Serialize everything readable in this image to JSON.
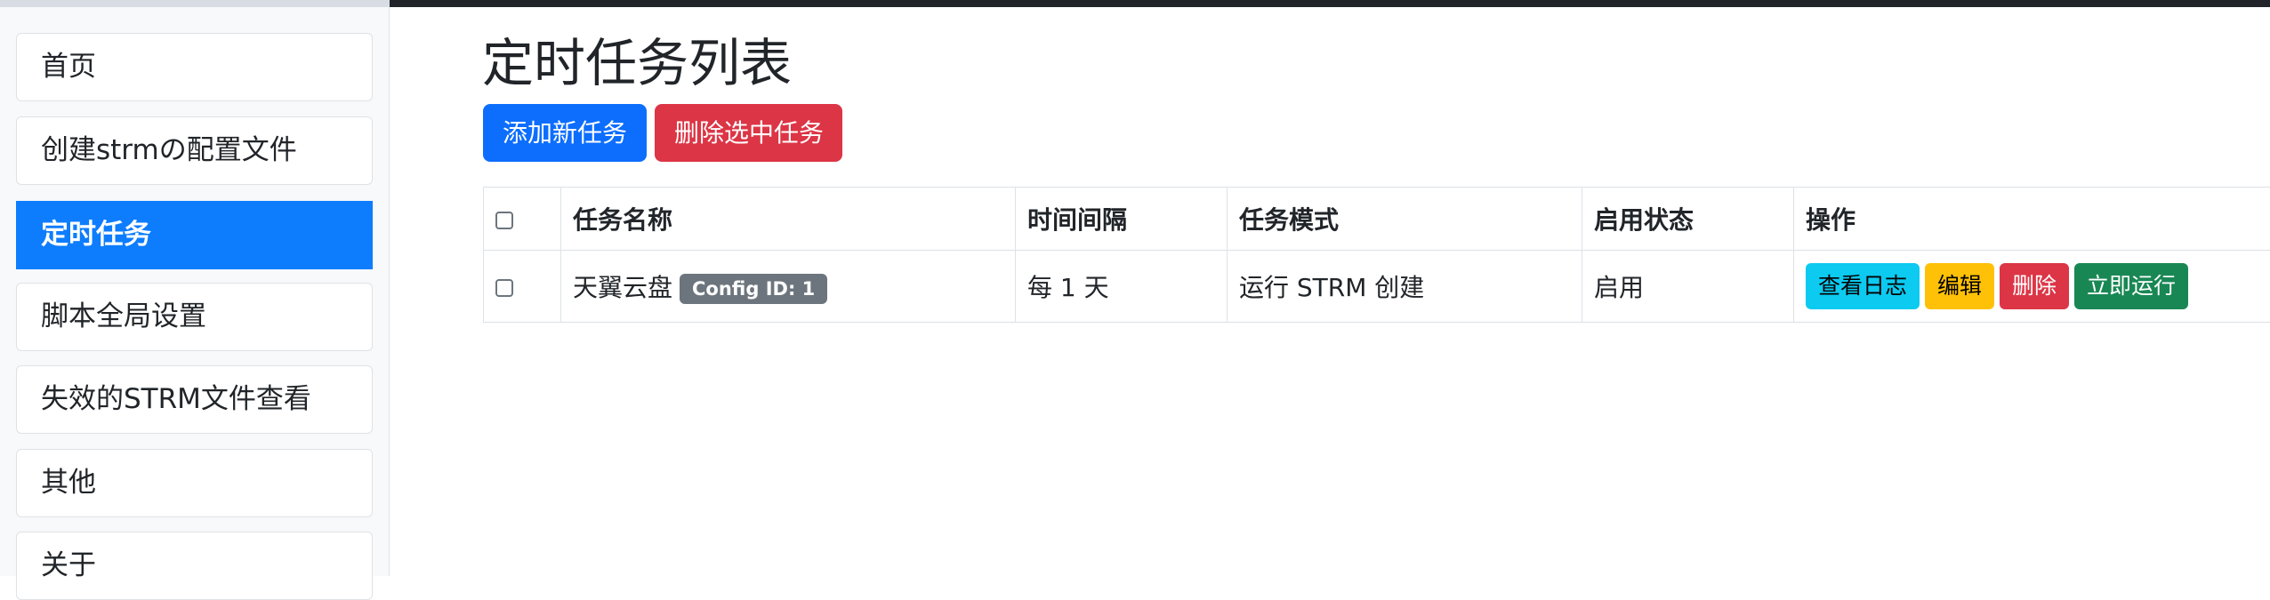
{
  "sidebar": {
    "items": [
      {
        "label": "首页"
      },
      {
        "label": "创建strmの配置文件"
      },
      {
        "label": "定时任务",
        "active": true
      },
      {
        "label": "脚本全局设置"
      },
      {
        "label": "失效的STRM文件查看"
      },
      {
        "label": "其他"
      },
      {
        "label": "关于"
      }
    ]
  },
  "main": {
    "title": "定时任务列表",
    "add_button": "添加新任务",
    "delete_selected_button": "删除选中任务",
    "table": {
      "headers": [
        "任务名称",
        "时间间隔",
        "任务模式",
        "启用状态",
        "操作"
      ],
      "rows": [
        {
          "name": "天翼云盘",
          "badge": "Config ID: 1",
          "interval": "每 1 天",
          "mode": "运行 STRM 创建",
          "status": "启用",
          "actions": {
            "logs": "查看日志",
            "edit": "编辑",
            "delete": "删除",
            "run": "立即运行"
          }
        }
      ]
    }
  },
  "colors": {
    "primary": "#0d6efd",
    "sidebar_active": "#0d7dfd",
    "danger": "#dc3545",
    "info": "#0dcaf0",
    "warning": "#ffc107",
    "success": "#198754",
    "badge": "#6c757d"
  }
}
